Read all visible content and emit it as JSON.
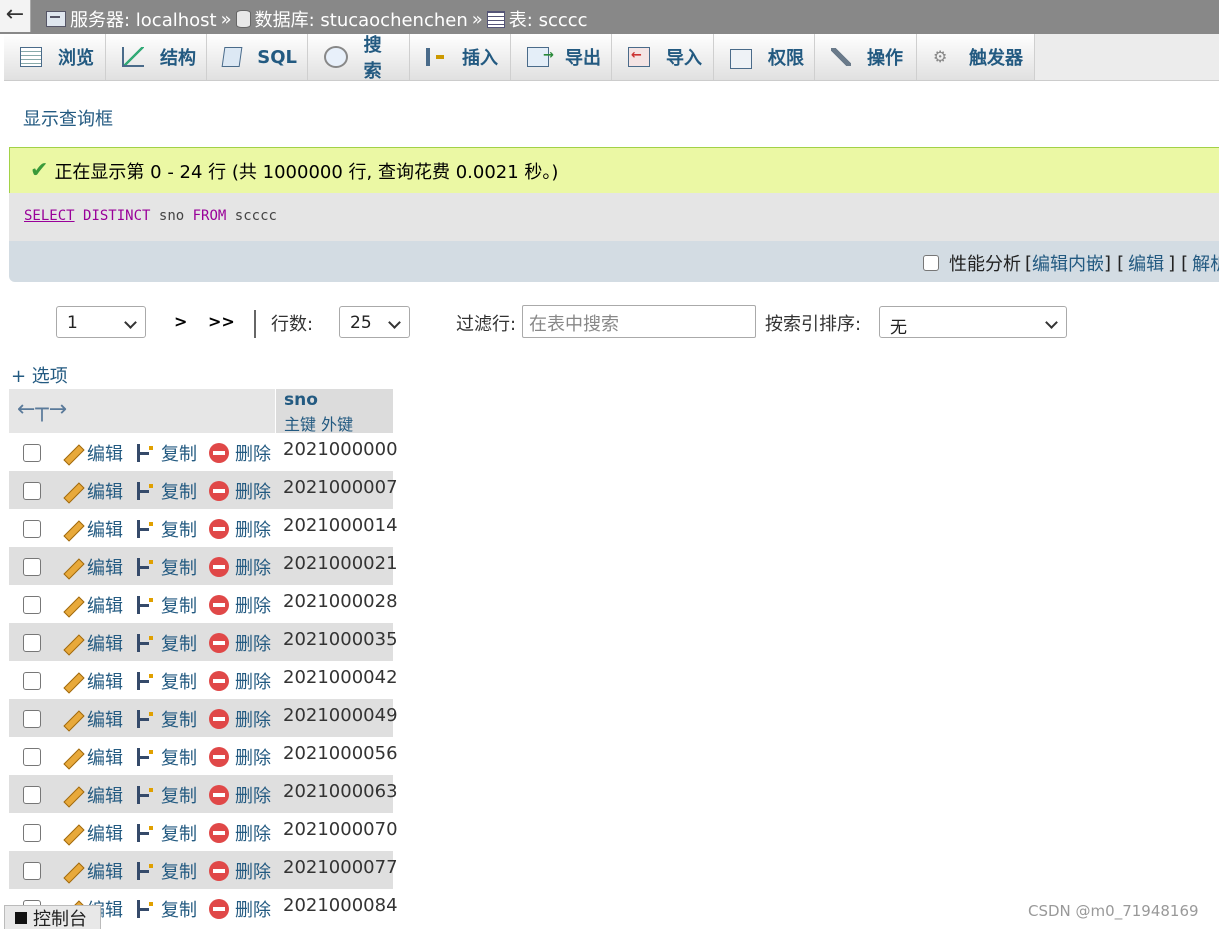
{
  "breadcrumb": {
    "back": "←",
    "server": "服务器: localhost",
    "database": "数据库: stucaochenchen",
    "table": "表: scccc",
    "separator": "»"
  },
  "tabs": [
    {
      "label": "浏览",
      "icon": "browse-icon"
    },
    {
      "label": "结构",
      "icon": "structure-icon"
    },
    {
      "label": "SQL",
      "icon": "sql-icon"
    },
    {
      "label": "搜索",
      "icon": "search-icon"
    },
    {
      "label": "插入",
      "icon": "insert-icon"
    },
    {
      "label": "导出",
      "icon": "export-icon"
    },
    {
      "label": "导入",
      "icon": "import-icon"
    },
    {
      "label": "权限",
      "icon": "privileges-icon"
    },
    {
      "label": "操作",
      "icon": "operations-icon"
    },
    {
      "label": "触发器",
      "icon": "triggers-icon"
    }
  ],
  "show_query_link": "显示查询框",
  "success_message": "正在显示第 0 - 24 行 (共 1000000 行, 查询花费 0.0021 秒。)",
  "sql": {
    "select": "SELECT",
    "distinct": "DISTINCT",
    "column": "sno",
    "from": "FROM",
    "table": "scccc"
  },
  "sql_footer": {
    "profiling": "性能分析",
    "edit_inline": "编辑内嵌",
    "edit": "编辑",
    "explain": "解析",
    "bracket_open": "[",
    "bracket_close": "]"
  },
  "navigation": {
    "page": "1",
    "next": ">",
    "last": ">>",
    "rows_label": "行数:",
    "rows_value": "25",
    "filter_label": "过滤行:",
    "filter_placeholder": "在表中搜索",
    "sort_label": "按索引排序:",
    "sort_value": "无"
  },
  "options_link": "+ 选项",
  "table": {
    "column": "sno",
    "key_primary": "主键",
    "key_foreign": "外键",
    "action_edit": "编辑",
    "action_copy": "复制",
    "action_delete": "删除",
    "rows": [
      "2021000000",
      "2021000007",
      "2021000014",
      "2021000021",
      "2021000028",
      "2021000035",
      "2021000042",
      "2021000049",
      "2021000056",
      "2021000063",
      "2021000070",
      "2021000077",
      "2021000084"
    ]
  },
  "console_label": "控制台",
  "watermark": "CSDN @m0_71948169"
}
